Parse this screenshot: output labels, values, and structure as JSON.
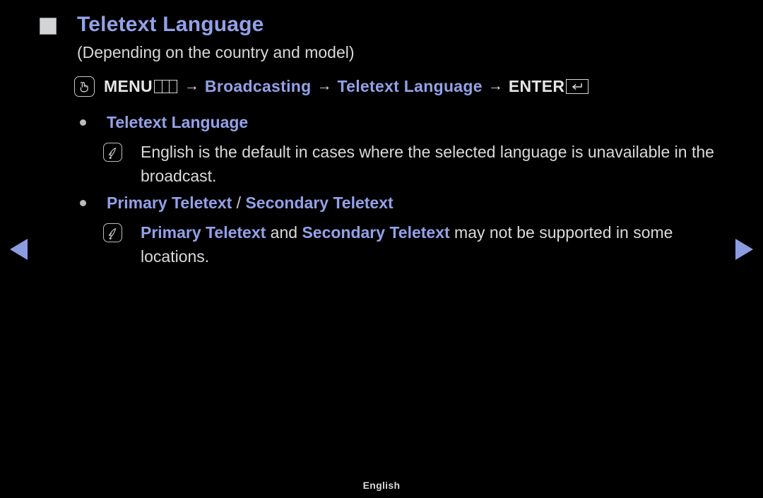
{
  "screen": {
    "background_color": "#000000",
    "accent_color": "#93a1e8",
    "text_color": "#dcdcdc",
    "arrow_color": "#8c9ce2"
  },
  "header": {
    "title": "Teletext Language",
    "subtitle": "(Depending on the country and model)",
    "marker_icon": "filled-square-icon"
  },
  "menu_path": {
    "press_icon": "remote-press-icon",
    "menu_label": "MENU",
    "menu_key_icon": "menu-key-icon",
    "arrow": "→",
    "step_broadcasting": "Broadcasting",
    "step_teletext_language": "Teletext Language",
    "enter_label": "ENTER",
    "enter_key_icon": "enter-return-key-icon"
  },
  "sections": [
    {
      "bullet_icon": "bullet-dot-icon",
      "label": "Teletext Language",
      "note": {
        "icon": "note-pen-icon",
        "parts": [
          {
            "text": "English is the default in cases where the selected language is unavailable in the broadcast.",
            "bold": false
          }
        ]
      }
    },
    {
      "bullet_icon": "bullet-dot-icon",
      "label_primary": "Primary Teletext",
      "label_separator": " / ",
      "label_secondary": "Secondary Teletext",
      "note": {
        "icon": "note-pen-icon",
        "parts": [
          {
            "text": "Primary Teletext",
            "bold": true
          },
          {
            "text": " and ",
            "bold": false
          },
          {
            "text": "Secondary Teletext",
            "bold": true
          },
          {
            "text": " may not be supported in some locations.",
            "bold": false
          }
        ]
      }
    }
  ],
  "navigation": {
    "previous_label": "previous-page-arrow",
    "next_label": "next-page-arrow"
  },
  "footer": {
    "language": "English"
  }
}
